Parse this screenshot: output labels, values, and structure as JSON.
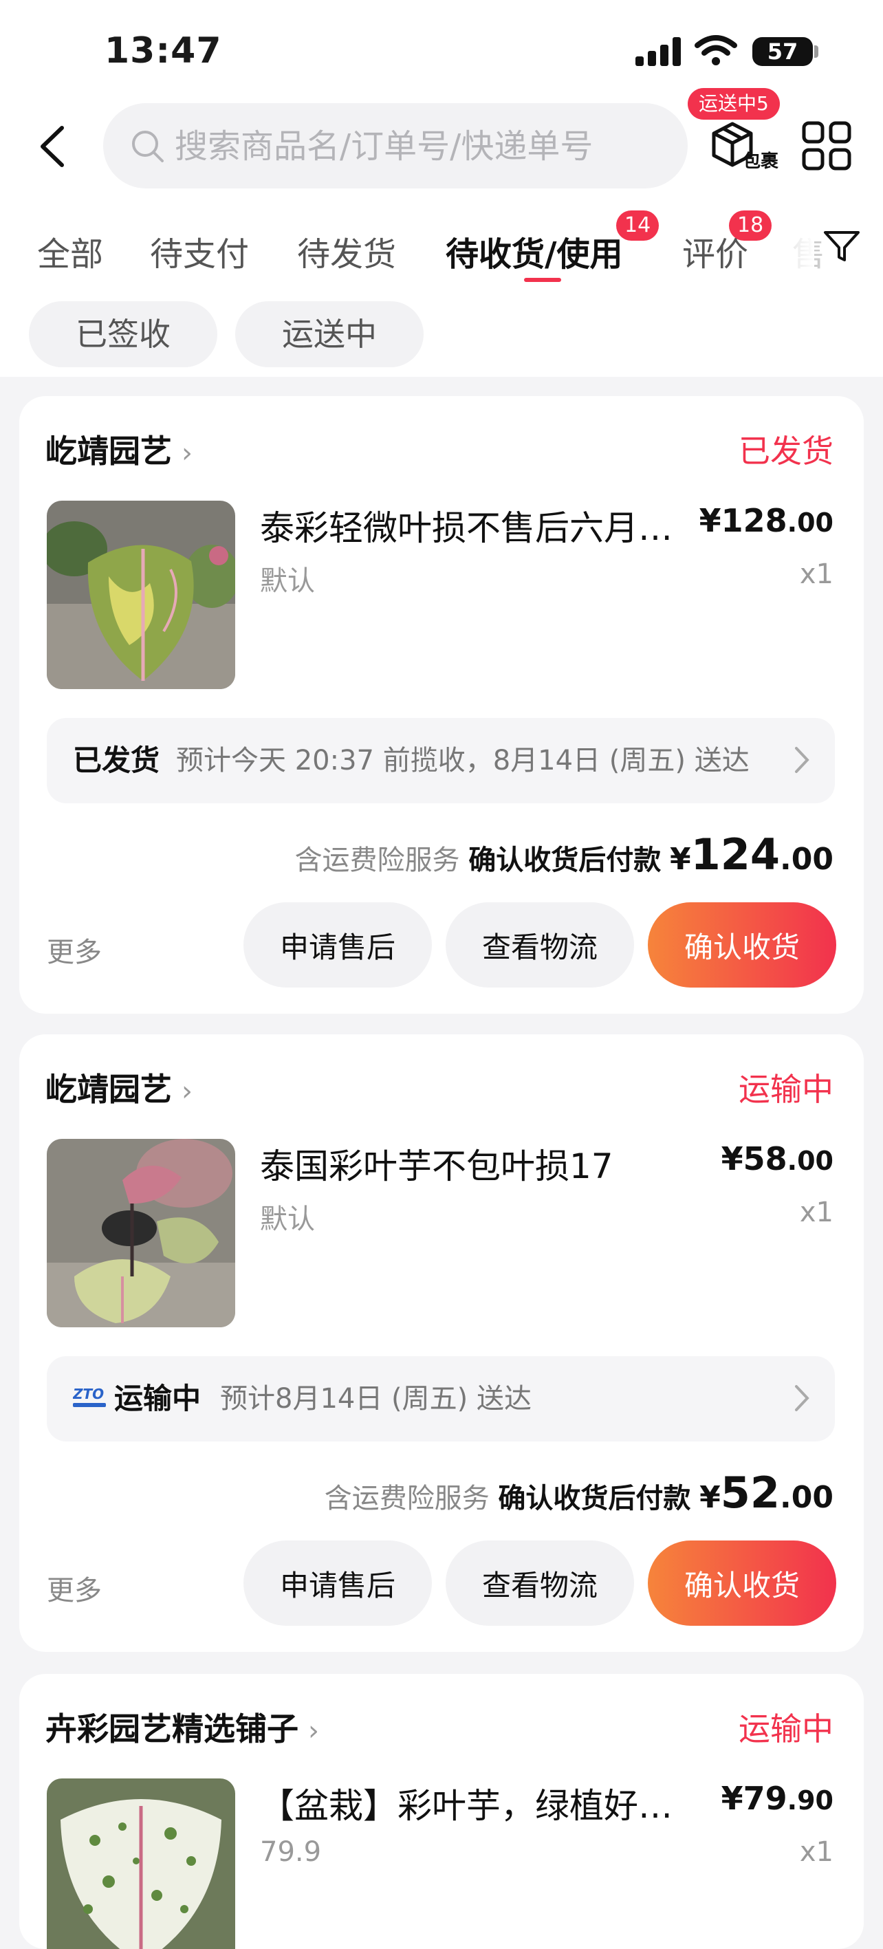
{
  "status_bar": {
    "time": "13:47",
    "battery": "57"
  },
  "header": {
    "search_placeholder": "搜索商品名/订单号/快递单号",
    "package_label": "包裹",
    "package_badge": "运送中5"
  },
  "tabs": [
    {
      "label": "全部"
    },
    {
      "label": "待支付"
    },
    {
      "label": "待发货"
    },
    {
      "label": "待收货/使用",
      "badge": "14",
      "active": true
    },
    {
      "label": "评价",
      "badge": "18"
    },
    {
      "label": "售"
    }
  ],
  "chips": [
    "已签收",
    "运送中"
  ],
  "orders": [
    {
      "shop": "屹靖园艺",
      "status": "已发货",
      "title": "泰彩轻微叶损不售后六月大红叶损",
      "sku": "默认",
      "price_int": "¥128",
      "price_dec": ".00",
      "qty": "x1",
      "shipping_label": "已发货",
      "shipping_text": "预计今天 20:37 前揽收，8月14日 (周五) 送达",
      "service": "含运费险服务",
      "pay_label": "确认收货后付款",
      "pay_int": "124",
      "pay_dec": ".00",
      "more": "更多",
      "btn_aftersale": "申请售后",
      "btn_logistics": "查看物流",
      "btn_confirm": "确认收货"
    },
    {
      "shop": "屹靖园艺",
      "status": "运输中",
      "title": "泰国彩叶芋不包叶损17",
      "sku": "默认",
      "price_int": "¥58",
      "price_dec": ".00",
      "qty": "x1",
      "shipping_label": "运输中",
      "shipping_text": "预计8月14日 (周五) 送达",
      "service": "含运费险服务",
      "pay_label": "确认收货后付款",
      "pay_int": "52",
      "pay_dec": ".00",
      "more": "更多",
      "btn_aftersale": "申请售后",
      "btn_logistics": "查看物流",
      "btn_confirm": "确认收货"
    },
    {
      "shop": "卉彩园艺精选铺子",
      "status": "运输中",
      "title": "【盆栽】彩叶芋，绿植好养活盆栽",
      "sku": "79.9",
      "price_int": "¥79",
      "price_dec": ".90",
      "qty": "x1"
    }
  ],
  "currency_symbol": "¥",
  "colors": {
    "accent": "#f2324d",
    "accent_gradient_start": "#f6843b",
    "page_bg": "#f4f4f6"
  }
}
